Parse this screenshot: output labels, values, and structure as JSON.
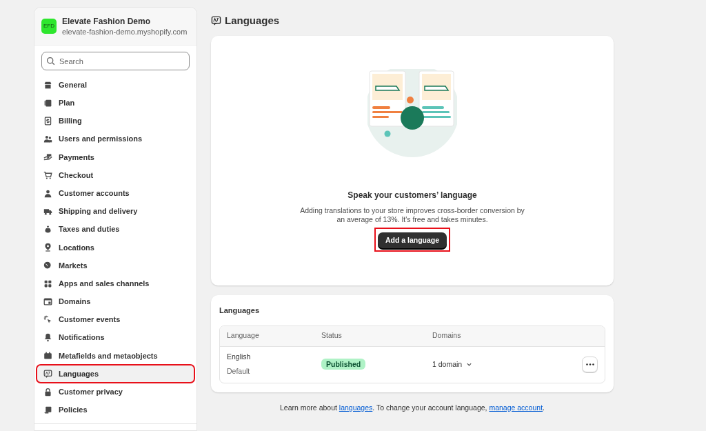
{
  "store": {
    "initials": "EFD",
    "name": "Elevate Fashion Demo",
    "domain": "elevate-fashion-demo.myshopify.com"
  },
  "search": {
    "placeholder": "Search"
  },
  "sidebar": {
    "items": [
      {
        "label": "General",
        "selected": false,
        "highlighted": false
      },
      {
        "label": "Plan",
        "selected": false,
        "highlighted": false
      },
      {
        "label": "Billing",
        "selected": false,
        "highlighted": false
      },
      {
        "label": "Users and permissions",
        "selected": false,
        "highlighted": false
      },
      {
        "label": "Payments",
        "selected": false,
        "highlighted": false
      },
      {
        "label": "Checkout",
        "selected": false,
        "highlighted": false
      },
      {
        "label": "Customer accounts",
        "selected": false,
        "highlighted": false
      },
      {
        "label": "Shipping and delivery",
        "selected": false,
        "highlighted": false
      },
      {
        "label": "Taxes and duties",
        "selected": false,
        "highlighted": false
      },
      {
        "label": "Locations",
        "selected": false,
        "highlighted": false
      },
      {
        "label": "Markets",
        "selected": false,
        "highlighted": false
      },
      {
        "label": "Apps and sales channels",
        "selected": false,
        "highlighted": false
      },
      {
        "label": "Domains",
        "selected": false,
        "highlighted": false
      },
      {
        "label": "Customer events",
        "selected": false,
        "highlighted": false
      },
      {
        "label": "Notifications",
        "selected": false,
        "highlighted": false
      },
      {
        "label": "Metafields and metaobjects",
        "selected": false,
        "highlighted": false
      },
      {
        "label": "Languages",
        "selected": true,
        "highlighted": true
      },
      {
        "label": "Customer privacy",
        "selected": false,
        "highlighted": false
      },
      {
        "label": "Policies",
        "selected": false,
        "highlighted": false
      }
    ]
  },
  "page": {
    "title": "Languages"
  },
  "empty_state": {
    "heading": "Speak your customers’ language",
    "body": "Adding translations to your store improves cross-border conversion by an average of 13%. It's free and takes minutes.",
    "button": {
      "label": "Add a language",
      "highlighted": true
    }
  },
  "languages_card": {
    "title": "Languages",
    "table": {
      "columns": [
        "Language",
        "Status",
        "Domains"
      ],
      "rows": [
        {
          "language": "English",
          "note": "Default",
          "status": "Published",
          "domains": "1 domain"
        }
      ]
    }
  },
  "footer": [
    {
      "text": "Learn more about ",
      "link": false
    },
    {
      "text": "languages",
      "link": true
    },
    {
      "text": ". To change your account language, ",
      "link": false
    },
    {
      "text": "manage account",
      "link": true
    },
    {
      "text": ".",
      "link": false
    }
  ]
}
